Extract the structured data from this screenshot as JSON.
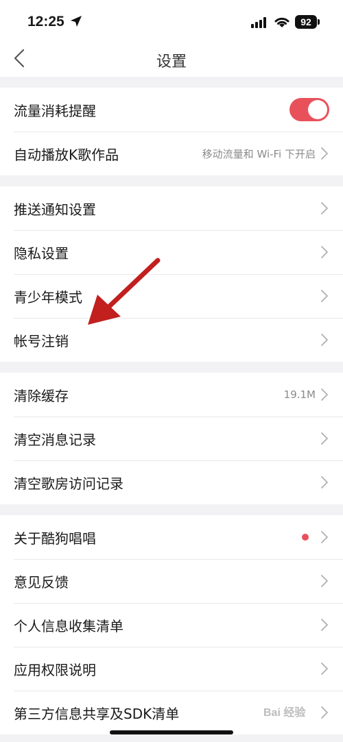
{
  "status_bar": {
    "time": "12:25",
    "battery": "92"
  },
  "nav": {
    "title": "设置"
  },
  "groups": [
    [
      {
        "label": "流量消耗提醒",
        "toggle": true
      },
      {
        "label": "自动播放K歌作品",
        "value": "移动流量和 Wi-Fi 下开启"
      }
    ],
    [
      {
        "label": "推送通知设置"
      },
      {
        "label": "隐私设置"
      },
      {
        "label": "青少年模式"
      },
      {
        "label": "帐号注销"
      }
    ],
    [
      {
        "label": "清除缓存",
        "value": "19.1M"
      },
      {
        "label": "清空消息记录"
      },
      {
        "label": "清空歌房访问记录"
      }
    ],
    [
      {
        "label": "关于酷狗唱唱",
        "badge_dot": true
      },
      {
        "label": "意见反馈"
      },
      {
        "label": "个人信息收集清单"
      },
      {
        "label": "应用权限说明"
      },
      {
        "label": "第三方信息共享及SDK清单"
      }
    ]
  ],
  "colors": {
    "accent": "#e9515a",
    "annotation_arrow": "#c21f1f"
  },
  "watermark": "Bai 经验"
}
